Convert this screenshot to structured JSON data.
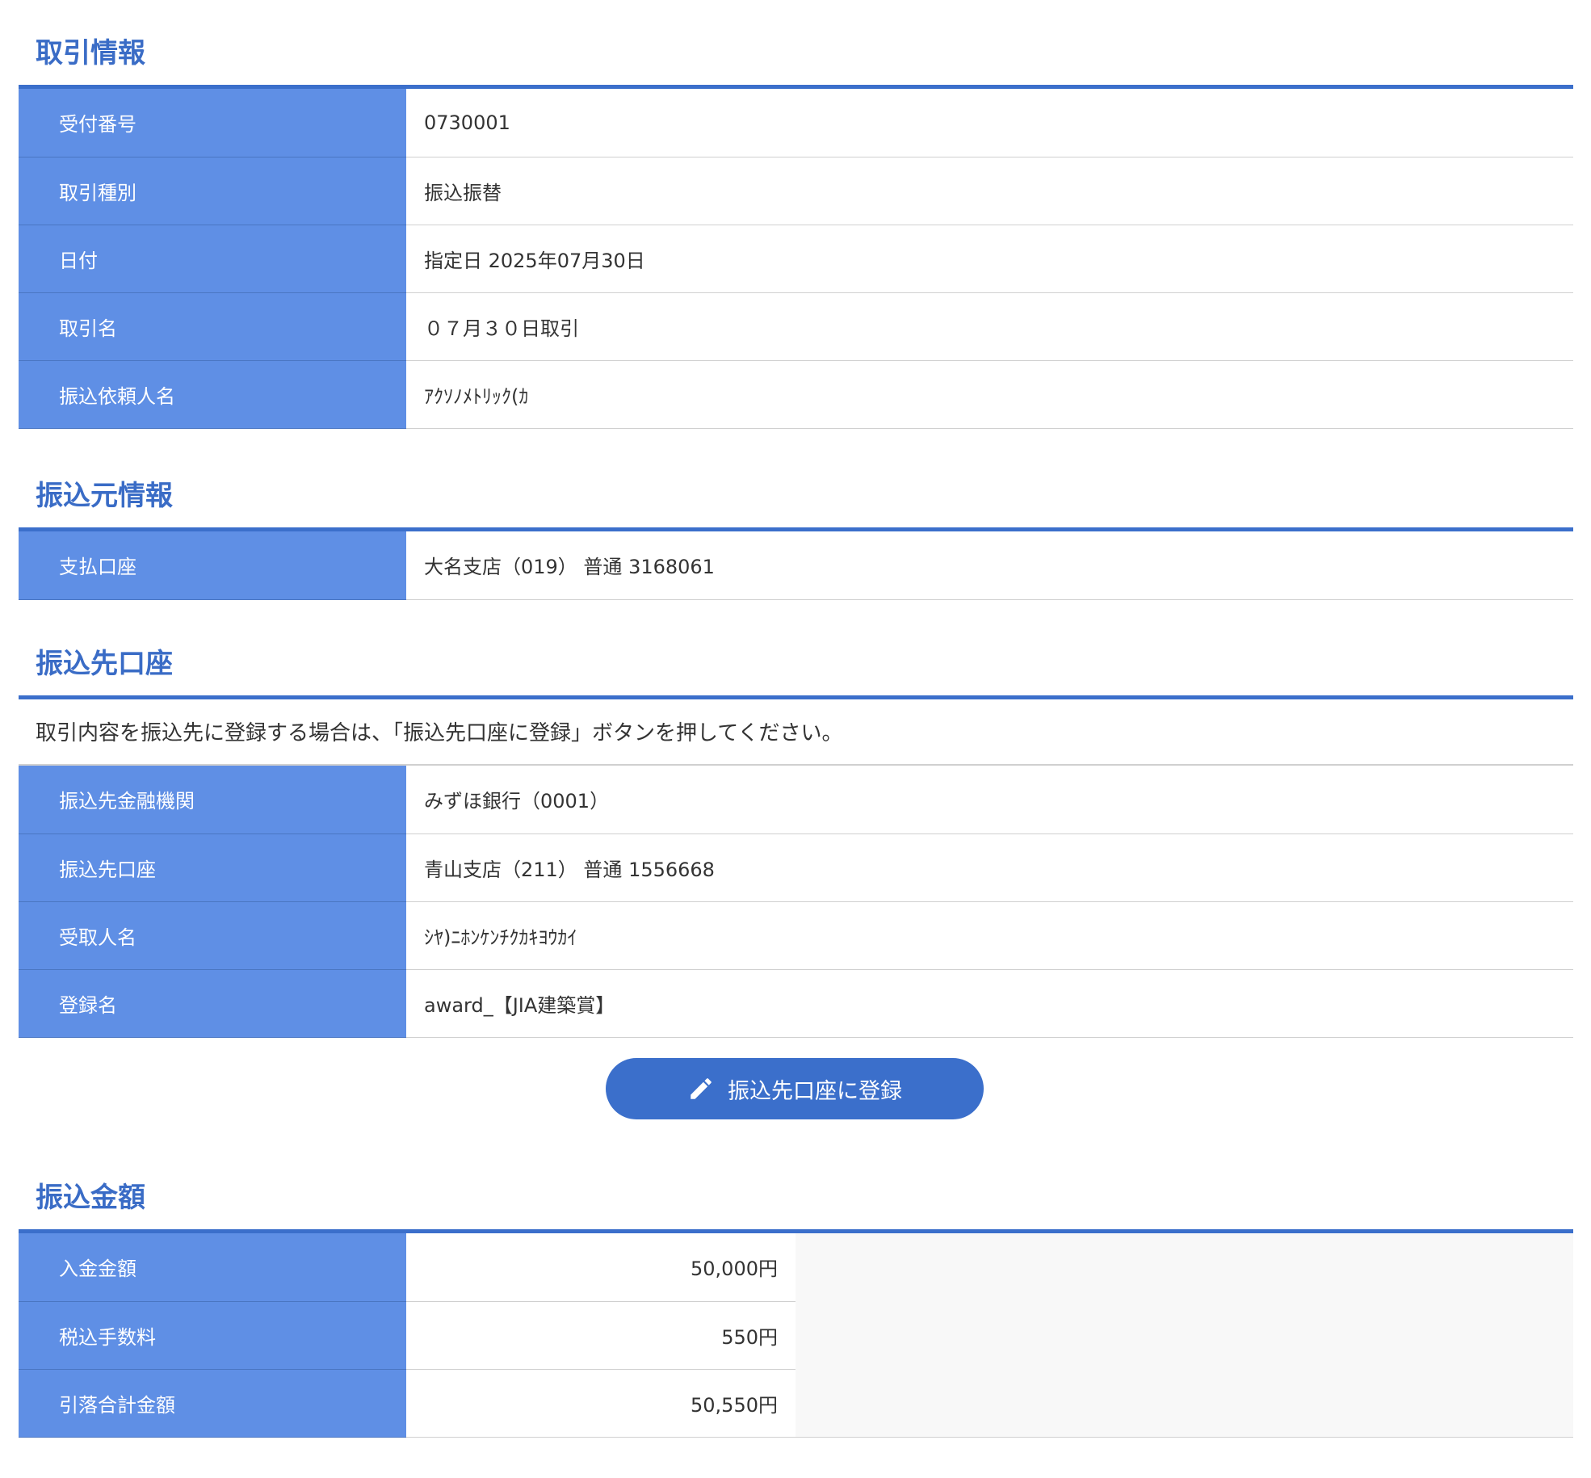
{
  "transaction_info": {
    "title": "取引情報",
    "rows": [
      {
        "label": "受付番号",
        "value": "0730001"
      },
      {
        "label": "取引種別",
        "value": "振込振替"
      },
      {
        "label": "日付",
        "value": "指定日 2025年07月30日"
      },
      {
        "label": "取引名",
        "value": "０７月３０日取引"
      },
      {
        "label": "振込依頼人名",
        "value": "ｱｸｿﾉﾒﾄﾘｯｸ(ｶ"
      }
    ]
  },
  "source_info": {
    "title": "振込元情報",
    "rows": [
      {
        "label": "支払口座",
        "value": "大名支店（019） 普通 3168061"
      }
    ]
  },
  "destination_info": {
    "title": "振込先口座",
    "instruction": "取引内容を振込先に登録する場合は、「振込先口座に登録」ボタンを押してください。",
    "rows": [
      {
        "label": "振込先金融機関",
        "value": "みずほ銀行（0001）"
      },
      {
        "label": "振込先口座",
        "value": "青山支店（211） 普通 1556668"
      },
      {
        "label": "受取人名",
        "value": "ｼﾔ)ﾆﾎﾝｹﾝﾁｸｶｷﾖｳｶｲ"
      },
      {
        "label": "登録名",
        "value": "award_【JIA建築賞】"
      }
    ],
    "register_button": {
      "label": "振込先口座に登録",
      "icon": "pencil-icon"
    }
  },
  "amount_info": {
    "title": "振込金額",
    "rows": [
      {
        "label": "入金金額",
        "value": "50,000円"
      },
      {
        "label": "税込手数料",
        "value": "550円"
      },
      {
        "label": "引落合計金額",
        "value": "50,550円"
      }
    ]
  },
  "colors": {
    "accent": "#3b6fcb",
    "label_background": "#5f8fe5",
    "title_text": "#3a6cc6"
  }
}
